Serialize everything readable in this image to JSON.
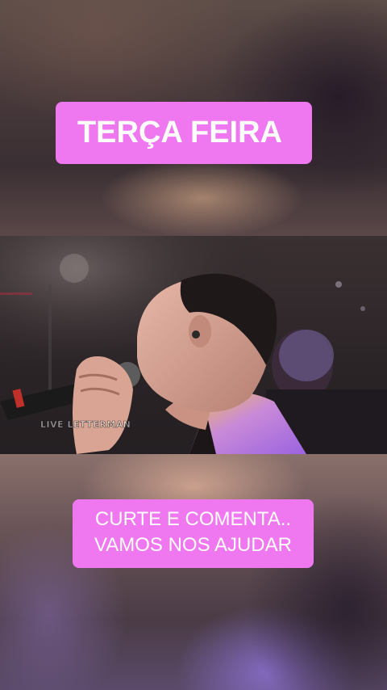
{
  "captions": {
    "top": "TERÇA FEIRA",
    "bottom_line1": "CURTE E COMENTA..",
    "bottom_line2": "VAMOS NOS AJUDAR"
  },
  "video": {
    "watermark": "LIVE LETTERMAN"
  },
  "colors": {
    "caption_background": "#ef77f0",
    "caption_text": "#ffffff"
  }
}
